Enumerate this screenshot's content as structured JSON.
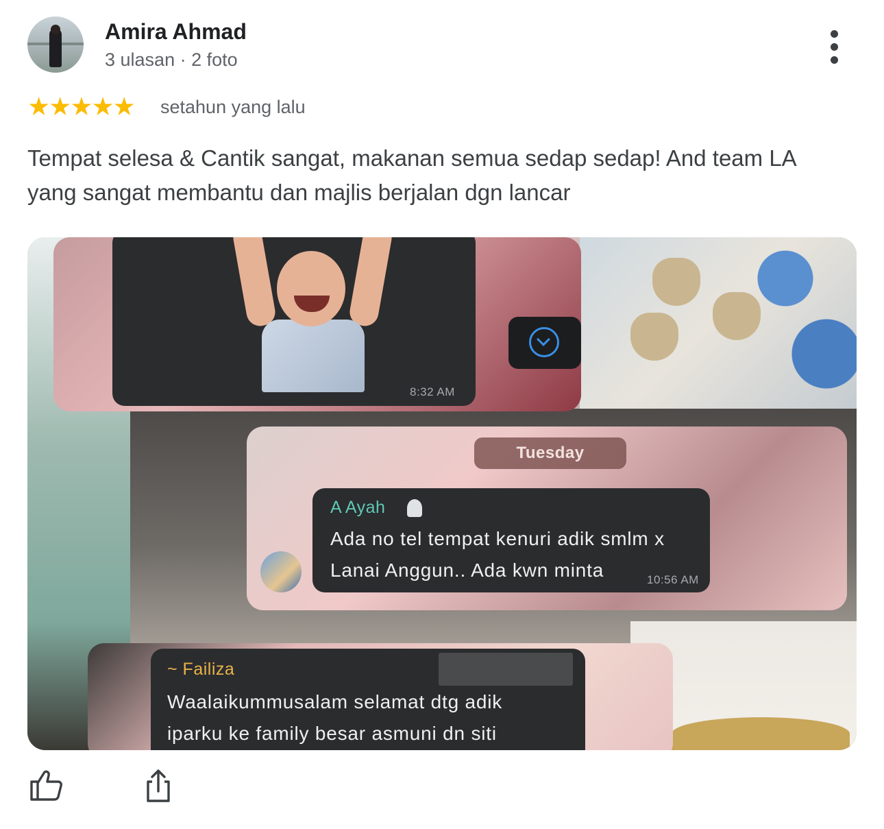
{
  "reviewer": {
    "name": "Amira Ahmad",
    "meta": "3 ulasan · 2 foto"
  },
  "rating": {
    "stars": 5,
    "stars_text": "★★★★★",
    "time": "setahun yang lalu"
  },
  "review": {
    "text": "Tempat selesa & Cantik sangat, makanan semua sedap sedap! And team LA yang sangat membantu dan majlis berjalan dgn lancar"
  },
  "photo": {
    "top_card": {
      "time": "8:32 AM"
    },
    "mid_card": {
      "day": "Tuesday",
      "sender": "A Ayah",
      "line1": "Ada no tel tempat kenuri adik smlm x",
      "line2": "Lanai Anggun.. Ada kwn minta",
      "time": "10:56 AM"
    },
    "bottom_card": {
      "sender": "~ Failiza",
      "line1": "Waalaikummusalam selamat dtg adik",
      "line2": "iparku ke family besar  asmuni dn siti"
    }
  },
  "icons": {
    "menu": "more-vert-icon",
    "like": "thumb-up-icon",
    "share": "share-icon",
    "scroll": "chevron-down-circle-icon"
  },
  "colors": {
    "star": "#fbbc04",
    "sender_teal": "#5fc9b5",
    "sender_gold": "#e9b24a",
    "scroll_blue": "#3a8fe6"
  }
}
